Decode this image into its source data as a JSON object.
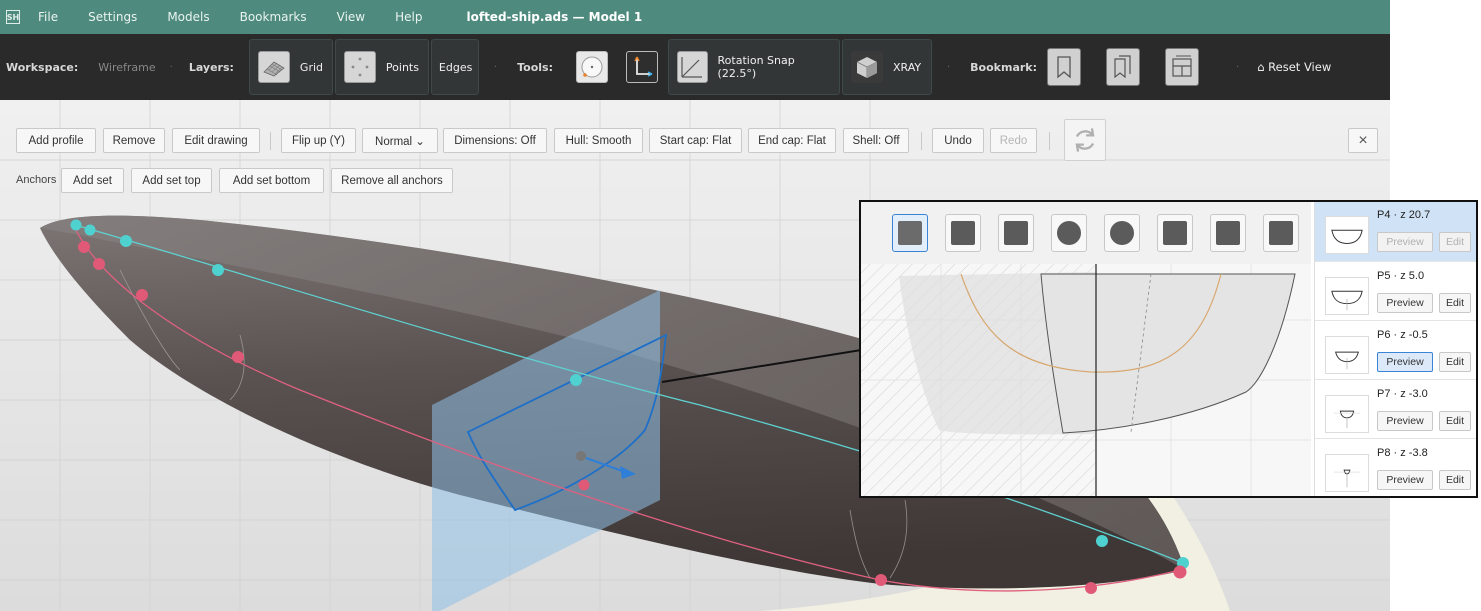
{
  "menubar": {
    "app_icon": "app-logo-icon",
    "items": [
      "File",
      "Settings",
      "Models",
      "Bookmarks",
      "View",
      "Help"
    ],
    "document_title": "lofted-ship.ads — Model 1"
  },
  "toolbar": {
    "workspace_label": "Workspace:",
    "workspace_value": "Wireframe",
    "layers_label": "Layers:",
    "grid_label": "Grid",
    "points_label": "Points",
    "edges_label": "Edges",
    "tools_label": "Tools:",
    "rotation_snap_label": "Rotation Snap (22.5°)",
    "xray_label": "XRAY",
    "bookmark_label": "Bookmark:",
    "reset_view_label": "⌂ Reset View"
  },
  "editor": {
    "row1": [
      "Add profile",
      "Remove",
      "Edit drawing",
      "Flip up (Y)",
      "Normal ⌄",
      "Dimensions: Off",
      "Hull: Smooth",
      "Start cap: Flat",
      "End cap: Flat",
      "Shell: Off",
      "Undo",
      "Redo"
    ],
    "close_label": "×",
    "anchors_label": "Anchors",
    "row2": [
      "Add set",
      "Add set top",
      "Add set bottom",
      "Remove all anchors"
    ]
  },
  "profiles": [
    {
      "label": "P4 · z 20.7",
      "preview": "Preview",
      "edit": "Edit",
      "selected": true
    },
    {
      "label": "P5 · z 5.0",
      "preview": "Preview",
      "edit": "Edit",
      "selected": false
    },
    {
      "label": "P6 · z -0.5",
      "preview": "Preview",
      "edit": "Edit",
      "selected": false
    },
    {
      "label": "P7 · z -3.0",
      "preview": "Preview",
      "edit": "Edit",
      "selected": false
    },
    {
      "label": "P8 · z -3.8",
      "preview": "Preview",
      "edit": "Edit",
      "selected": false
    }
  ],
  "colors": {
    "menubar": "#4e8b7e",
    "toolbar": "#2a2a2a",
    "hull": "#5e5654",
    "top_anchor": "#4fd1d0",
    "bottom_anchor": "#e05a78",
    "profile_plane": "#8fbfe6",
    "selection": "#3a84d6"
  }
}
